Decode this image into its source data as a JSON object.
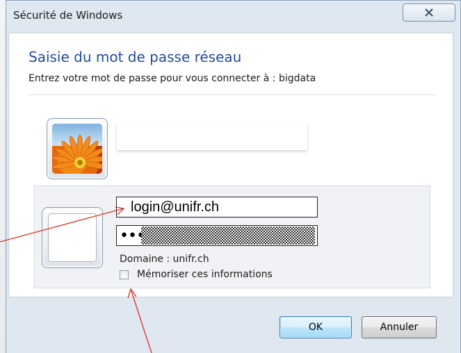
{
  "window": {
    "title": "Sécurité de Windows"
  },
  "dialog": {
    "heading": "Saisie du mot de passe réseau",
    "subheading": "Entrez votre mot de passe pour vous connecter à : bigdata"
  },
  "credentials": {
    "username_value": "login@unifr.ch",
    "password_mask": "•••",
    "domain_label": "Domaine : unifr.ch",
    "remember_label": "Mémoriser ces informations",
    "remember_checked": false
  },
  "buttons": {
    "ok_label": "OK",
    "cancel_label": "Annuler"
  },
  "colors": {
    "heading": "#234a9c",
    "annotation_arrow": "#e0301e",
    "window_frame": "#dfe7f1"
  },
  "icons": {
    "close": "close-x-icon",
    "user_tile_1": "flower-user-tile",
    "user_tile_2": "blank-user-tile"
  }
}
